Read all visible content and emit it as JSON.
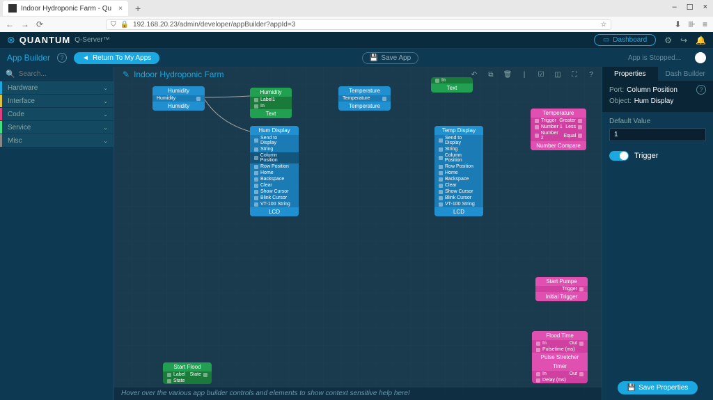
{
  "browser": {
    "tab_title": "Indoor Hydroponic Farm - Qu",
    "url": "192.168.20.23/admin/developer/appBuilder?appId=3"
  },
  "header": {
    "brand": "QUANTUM",
    "sub": "Q-Server™",
    "dashboard": "Dashboard"
  },
  "appbar": {
    "title": "App Builder",
    "return": "Return To My Apps",
    "save_app": "Save App",
    "status": "App is Stopped..."
  },
  "sidebar": {
    "search_placeholder": "Search...",
    "cats": [
      {
        "label": "Hardware"
      },
      {
        "label": "Interface"
      },
      {
        "label": "Code"
      },
      {
        "label": "Service"
      },
      {
        "label": "Misc"
      }
    ]
  },
  "canvas": {
    "title": "Indoor Hydroponic Farm",
    "help": "Hover over the various app builder controls and elements to show context sensitive help here!"
  },
  "nodes": {
    "humidity_sensor": {
      "title": "Humidity",
      "ports": [
        "Humidity"
      ],
      "footer": "Humidity"
    },
    "temp_sensor": {
      "title": "Temperature",
      "ports": [
        "Temperature"
      ],
      "footer": "Temperature"
    },
    "text1": {
      "title": "Humidity",
      "ports": [
        "Label1",
        "In"
      ],
      "footer": "Text"
    },
    "text2": {
      "title": "",
      "ports": [
        "In"
      ],
      "footer": "Text"
    },
    "hum_display": {
      "title": "Hum Display",
      "ports": [
        "Send to Display",
        "String",
        "Column Position",
        "Row Position",
        "Home",
        "Backspace",
        "Clear",
        "Show Cursor",
        "Blink Cursor",
        "VT-100 String"
      ],
      "footer": "LCD",
      "selected": "Column Position"
    },
    "temp_display": {
      "title": "Temp Display",
      "ports": [
        "Send to Display",
        "String",
        "Column Position",
        "Row Position",
        "Home",
        "Backspace",
        "Clear",
        "Show Cursor",
        "Blink Cursor",
        "VT-100 String"
      ],
      "footer": "LCD"
    },
    "temp_compare": {
      "title": "Temperature",
      "rows": [
        [
          "Trigger",
          "Greater"
        ],
        [
          "Number 1",
          "Less"
        ],
        [
          "Number 2",
          "Equal"
        ]
      ],
      "footer": "Number Compare"
    },
    "start_pumpe": {
      "title": "Start Pumpe",
      "ports": [
        "Trigger"
      ],
      "footer": "Initial Trigger"
    },
    "flood_time": {
      "title": "Flood Time",
      "rows": [
        [
          "In",
          "Out"
        ],
        [
          "Pulsetime (ms)",
          ""
        ]
      ],
      "footer": "Pulse Stretcher"
    },
    "timer": {
      "title": "Timer",
      "rows": [
        [
          "In",
          "Out"
        ],
        [
          "Delay (ms)",
          ""
        ]
      ]
    },
    "start_flood": {
      "title": "Start Flood",
      "rows": [
        [
          "Label",
          "State"
        ],
        [
          "State",
          ""
        ]
      ],
      "footer": ""
    }
  },
  "properties": {
    "tab_props": "Properties",
    "tab_dash": "Dash Builder",
    "port_label": "Port:",
    "port_value": "Column Position",
    "object_label": "Object:",
    "object_value": "Hum Display",
    "default_label": "Default Value",
    "default_value": "1",
    "trigger_label": "Trigger",
    "save": "Save Properties"
  }
}
